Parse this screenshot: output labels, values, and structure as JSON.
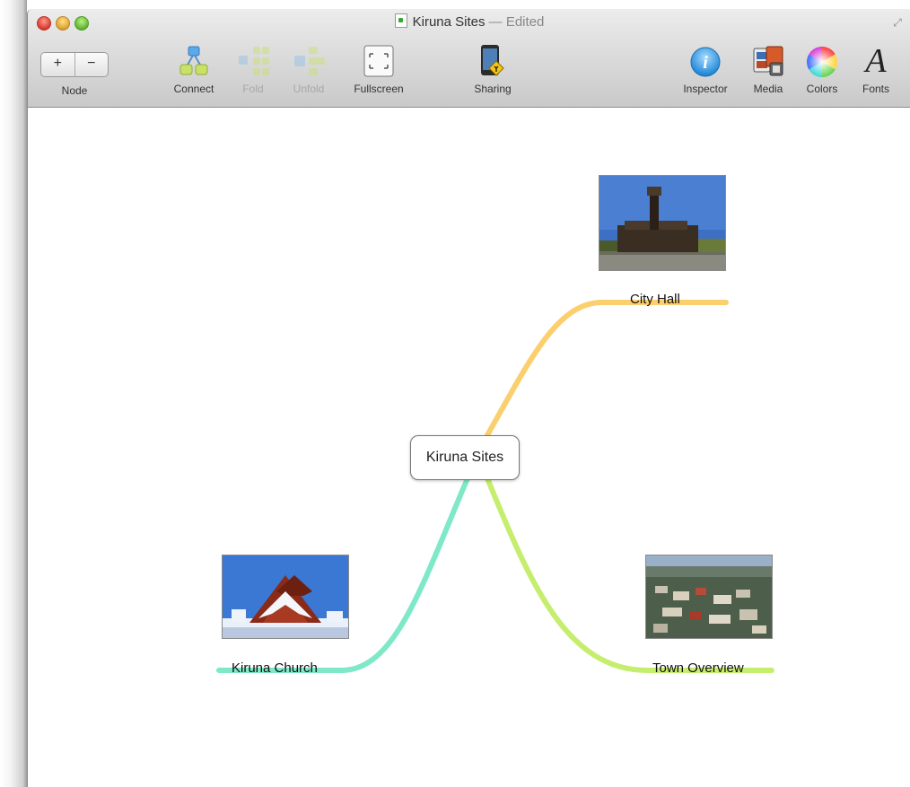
{
  "window": {
    "title": "Kiruna Sites",
    "title_separator": "—",
    "edited_label": "Edited"
  },
  "toolbar": {
    "node_label": "Node",
    "node_add": "+",
    "node_remove": "−",
    "connect_label": "Connect",
    "fold_label": "Fold",
    "unfold_label": "Unfold",
    "fullscreen_label": "Fullscreen",
    "sharing_label": "Sharing",
    "inspector_label": "Inspector",
    "media_label": "Media",
    "colors_label": "Colors",
    "fonts_label": "Fonts",
    "fonts_glyph": "A",
    "inspector_glyph": "i"
  },
  "map": {
    "central": "Kiruna Sites",
    "nodes": [
      {
        "label": "City Hall",
        "branch_color": "#fbcf6e"
      },
      {
        "label": "Kiruna Church",
        "branch_color": "#7ee8c8"
      },
      {
        "label": "Town Overview",
        "branch_color": "#c6ee6e"
      }
    ]
  }
}
